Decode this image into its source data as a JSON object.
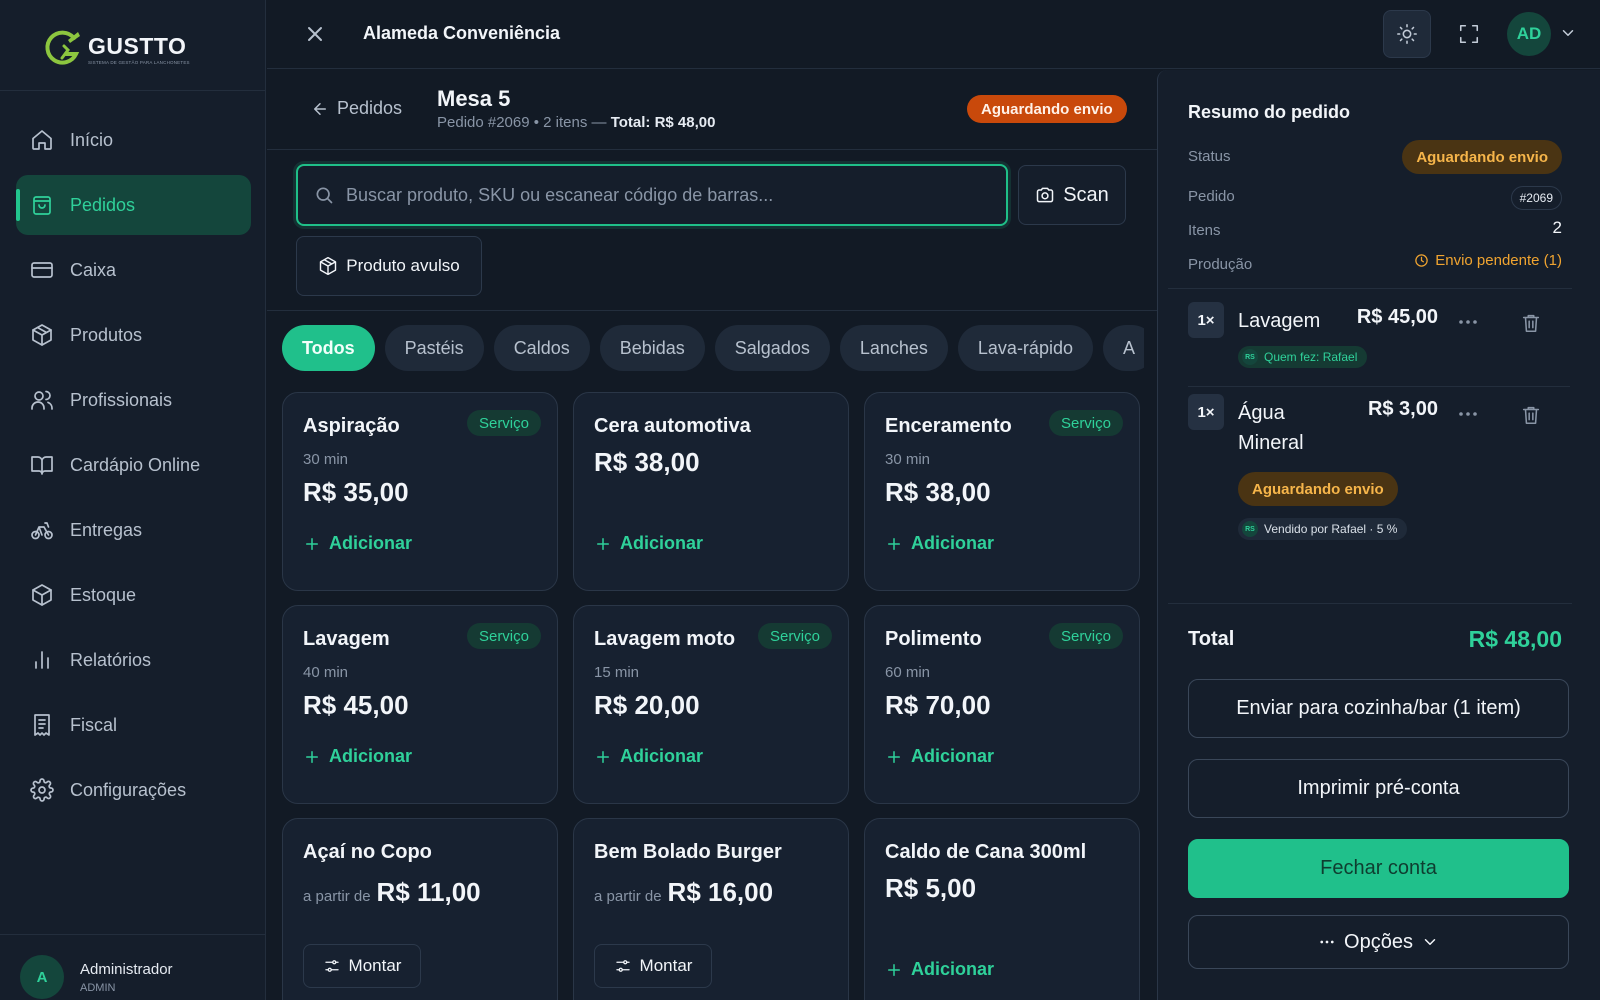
{
  "brand": {
    "name": "GUSTTO",
    "tagline": "SISTEMA DE GESTÃO PARA LANCHONETES",
    "accent": "#20c08b"
  },
  "sidebar": {
    "items": [
      {
        "label": "Início",
        "icon": "home-icon",
        "active": false
      },
      {
        "label": "Pedidos",
        "icon": "shopping-bag-icon",
        "active": true
      },
      {
        "label": "Caixa",
        "icon": "credit-card-icon",
        "active": false
      },
      {
        "label": "Produtos",
        "icon": "package-icon",
        "active": false
      },
      {
        "label": "Profissionais",
        "icon": "users-icon",
        "active": false
      },
      {
        "label": "Cardápio Online",
        "icon": "book-open-icon",
        "active": false
      },
      {
        "label": "Entregas",
        "icon": "bike-icon",
        "active": false
      },
      {
        "label": "Estoque",
        "icon": "boxes-icon",
        "active": false
      },
      {
        "label": "Relatórios",
        "icon": "bar-chart-icon",
        "active": false
      },
      {
        "label": "Fiscal",
        "icon": "receipt-icon",
        "active": false
      },
      {
        "label": "Configurações",
        "icon": "gear-icon",
        "active": false
      }
    ],
    "user": {
      "initial": "A",
      "name": "Administrador",
      "role": "ADMIN"
    }
  },
  "topbar": {
    "title": "Alameda Conveniência",
    "avatar": "AD"
  },
  "order": {
    "back_label": "Pedidos",
    "title": "Mesa 5",
    "subtitle": "Pedido #2069 • 2 itens — ",
    "subtitle_total": "Total: R$ 48,00",
    "status": "Aguardando envio"
  },
  "search": {
    "placeholder": "Buscar produto, SKU ou escanear código de barras...",
    "value": ""
  },
  "scan_label": "Scan",
  "avulso_label": "Produto avulso",
  "categories": [
    {
      "label": "Todos",
      "active": true
    },
    {
      "label": "Pastéis"
    },
    {
      "label": "Caldos"
    },
    {
      "label": "Bebidas"
    },
    {
      "label": "Salgados"
    },
    {
      "label": "Lanches"
    },
    {
      "label": "Lava-rápido"
    },
    {
      "label": "A"
    }
  ],
  "products": [
    {
      "name": "Aspiração",
      "badge": "Serviço",
      "duration": "30 min",
      "price": "R$ 35,00",
      "action": "Adicionar"
    },
    {
      "name": "Cera automotiva",
      "badge": "",
      "duration": "",
      "price": "R$ 38,00",
      "action": "Adicionar"
    },
    {
      "name": "Enceramento",
      "badge": "Serviço",
      "duration": "30 min",
      "price": "R$ 38,00",
      "action": "Adicionar"
    },
    {
      "name": "Lavagem",
      "badge": "Serviço",
      "duration": "40 min",
      "price": "R$ 45,00",
      "action": "Adicionar"
    },
    {
      "name": "Lavagem moto",
      "badge": "Serviço",
      "duration": "15 min",
      "price": "R$ 20,00",
      "action": "Adicionar"
    },
    {
      "name": "Polimento",
      "badge": "Serviço",
      "duration": "60 min",
      "price": "R$ 70,00",
      "action": "Adicionar"
    },
    {
      "name": "Açaí no Copo",
      "price_prefix": "a partir de",
      "price": "R$ 11,00",
      "action": "Montar"
    },
    {
      "name": "Bem Bolado Burger",
      "price_prefix": "a partir de",
      "price": "R$ 16,00",
      "action": "Montar"
    },
    {
      "name": "Caldo de Cana 300ml",
      "price": "R$ 5,00",
      "action": "Adicionar"
    }
  ],
  "summary": {
    "title": "Resumo do pedido",
    "status_label": "Status",
    "status_value": "Aguardando envio",
    "order_label": "Pedido",
    "order_value": "#2069",
    "items_label": "Itens",
    "items_value": "2",
    "production_label": "Produção",
    "production_value": "Envio pendente (1)",
    "items": [
      {
        "qty": "1×",
        "name": "Lavagem",
        "price": "R$ 45,00",
        "tag_rs": "RS",
        "tag": "Quem fez: Rafael"
      },
      {
        "qty": "1×",
        "name_line1": "Água",
        "name_line2": "Mineral",
        "price": "R$ 3,00",
        "status": "Aguardando envio",
        "tag_rs": "RS",
        "tag": "Vendido por Rafael · 5 %"
      }
    ],
    "total_label": "Total",
    "total_value": "R$ 48,00",
    "send_button": "Enviar para cozinha/bar (1 item)",
    "print_button": "Imprimir pré-conta",
    "close_button": "Fechar conta",
    "options_button": "Opções"
  }
}
